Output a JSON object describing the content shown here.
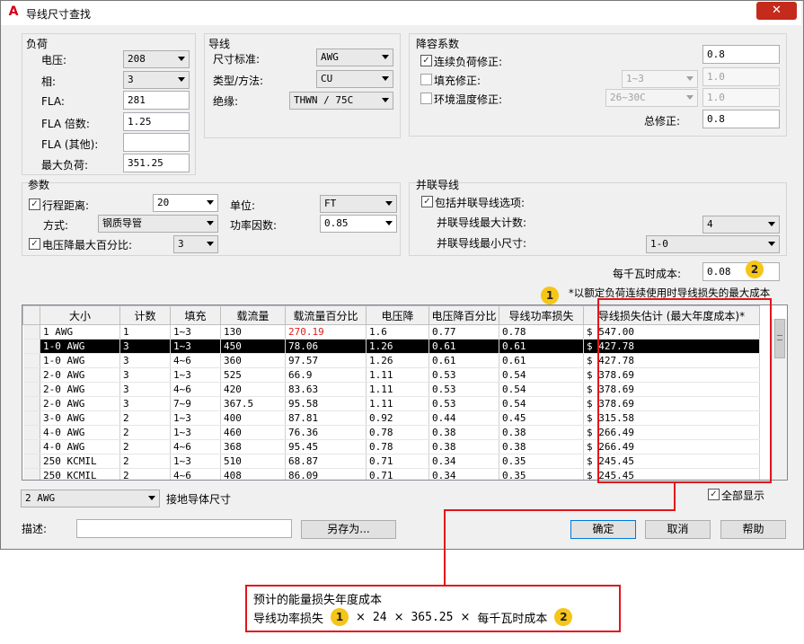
{
  "window": {
    "title": "导线尺寸查找",
    "close": "✕"
  },
  "load": {
    "title": "负荷",
    "voltage_label": "电压:",
    "voltage": "208",
    "phase_label": "相:",
    "phase": "3",
    "fla_label": "FLA:",
    "fla": "281",
    "fla_mult_label": "FLA 倍数:",
    "fla_mult": "1.25",
    "fla_other_label": "FLA (其他):",
    "fla_other": "",
    "max_load_label": "最大负荷:",
    "max_load": "351.25"
  },
  "wire": {
    "title": "导线",
    "standard_label": "尺寸标准:",
    "standard": "AWG",
    "type_label": "类型/方法:",
    "type": "CU",
    "insulation_label": "绝缘:",
    "insulation": "THWN / 75C"
  },
  "derate": {
    "title": "降容系数",
    "continuous_label": "连续负荷修正:",
    "continuous": "0.8",
    "fill_label": "填充修正:",
    "fill_sel": "1~3",
    "fill_val": "1.0",
    "ambient_label": "环境温度修正:",
    "ambient_sel": "26~30C",
    "ambient_val": "1.0",
    "total_label": "总修正:",
    "total": "0.8"
  },
  "params": {
    "title": "参数",
    "distance_label": "行程距离:",
    "distance": "20",
    "unit_label": "单位:",
    "unit": "FT",
    "method_label": "方式:",
    "method": "钢质导管",
    "pf_label": "功率因数:",
    "pf": "0.85",
    "vdrop_label": "电压降最大百分比:",
    "vdrop": "3"
  },
  "parallel": {
    "title": "并联导线",
    "include_label": "包括并联导线选项:",
    "max_count_label": "并联导线最大计数:",
    "max_count": "4",
    "min_size_label": "并联导线最小尺寸:",
    "min_size": "1-0"
  },
  "cost": {
    "label": "每千瓦时成本:",
    "value": "0.08",
    "note": "*以额定负荷连续使用时导线损失的最大成本"
  },
  "table": {
    "headers": [
      "大小",
      "计数",
      "填充",
      "载流量",
      "载流量百分比",
      "电压降",
      "电压降百分比",
      "导线功率损失",
      "导线损失估计 (最大年度成本)*"
    ],
    "rows": [
      [
        "1 AWG",
        "1",
        "1~3",
        "130",
        "270.19",
        "1.6",
        "0.77",
        "0.78",
        "$ 547.00"
      ],
      [
        "1-0 AWG",
        "3",
        "1~3",
        "450",
        "78.06",
        "1.26",
        "0.61",
        "0.61",
        "$ 427.78"
      ],
      [
        "1-0 AWG",
        "3",
        "4~6",
        "360",
        "97.57",
        "1.26",
        "0.61",
        "0.61",
        "$ 427.78"
      ],
      [
        "2-0 AWG",
        "3",
        "1~3",
        "525",
        "66.9",
        "1.11",
        "0.53",
        "0.54",
        "$ 378.69"
      ],
      [
        "2-0 AWG",
        "3",
        "4~6",
        "420",
        "83.63",
        "1.11",
        "0.53",
        "0.54",
        "$ 378.69"
      ],
      [
        "2-0 AWG",
        "3",
        "7~9",
        "367.5",
        "95.58",
        "1.11",
        "0.53",
        "0.54",
        "$ 378.69"
      ],
      [
        "3-0 AWG",
        "2",
        "1~3",
        "400",
        "87.81",
        "0.92",
        "0.44",
        "0.45",
        "$ 315.58"
      ],
      [
        "4-0 AWG",
        "2",
        "1~3",
        "460",
        "76.36",
        "0.78",
        "0.38",
        "0.38",
        "$ 266.49"
      ],
      [
        "4-0 AWG",
        "2",
        "4~6",
        "368",
        "95.45",
        "0.78",
        "0.38",
        "0.38",
        "$ 266.49"
      ],
      [
        "250 KCMIL",
        "2",
        "1~3",
        "510",
        "68.87",
        "0.71",
        "0.34",
        "0.35",
        "$ 245.45"
      ],
      [
        "250 KCMIL",
        "2",
        "4~6",
        "408",
        "86.09",
        "0.71",
        "0.34",
        "0.35",
        "$ 245.45"
      ]
    ]
  },
  "bottom": {
    "ground_sel": "2 AWG",
    "ground_label": "接地导体尺寸",
    "show_all_label": "全部显示",
    "desc_label": "描述:",
    "desc_value": "",
    "save_as": "另存为...",
    "ok": "确定",
    "cancel": "取消",
    "help": "帮助"
  },
  "callout": {
    "line1": "预计的能量损失年度成本",
    "f1": "导线功率损失",
    "b1": "1",
    "x1": "×",
    "n24": "24",
    "x2": "×",
    "n365": "365.25",
    "x3": "×",
    "f2": "每千瓦时成本",
    "b2": "2"
  },
  "badges": {
    "one": "1",
    "two": "2"
  },
  "colors": {
    "annotation": "#e3141b",
    "badge": "#f5c518",
    "selected_row": "#000000",
    "warn_value": "#e02020"
  }
}
